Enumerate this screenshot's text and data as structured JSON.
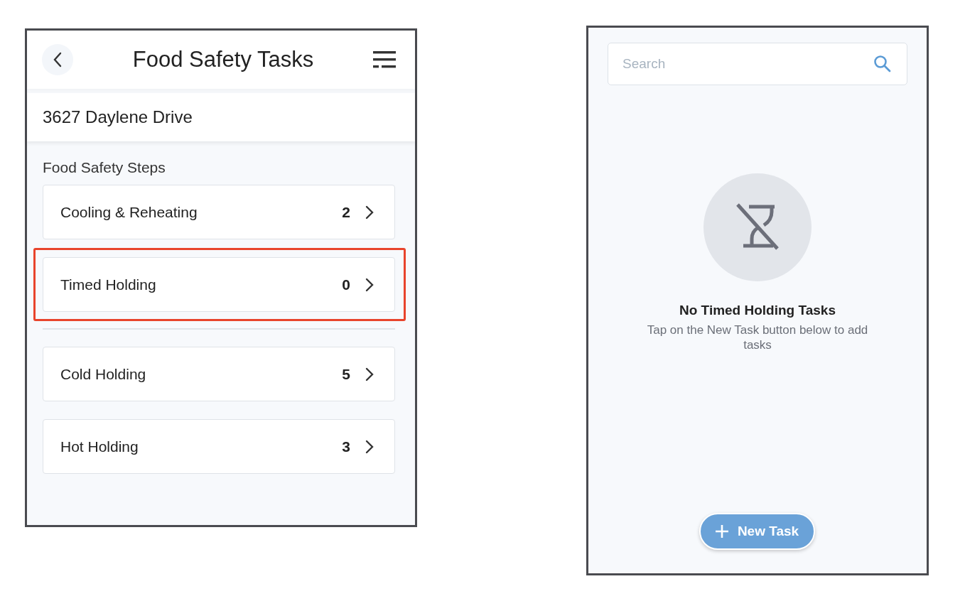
{
  "left_screen": {
    "header": {
      "title": "Food Safety Tasks"
    },
    "location": "3627 Daylene Drive",
    "section_title": "Food Safety Steps",
    "groups": [
      {
        "items": [
          {
            "label": "Cooling & Reheating",
            "count": "2",
            "highlighted": false
          },
          {
            "label": "Timed Holding",
            "count": "0",
            "highlighted": true
          }
        ]
      },
      {
        "items": [
          {
            "label": "Cold Holding",
            "count": "5",
            "highlighted": false
          },
          {
            "label": "Hot Holding",
            "count": "3",
            "highlighted": false
          }
        ]
      }
    ]
  },
  "right_screen": {
    "search": {
      "placeholder": "Search"
    },
    "empty_state": {
      "title": "No Timed Holding Tasks",
      "message": "Tap on the New Task button below to add tasks"
    },
    "new_task_button": {
      "label": "New Task"
    }
  }
}
